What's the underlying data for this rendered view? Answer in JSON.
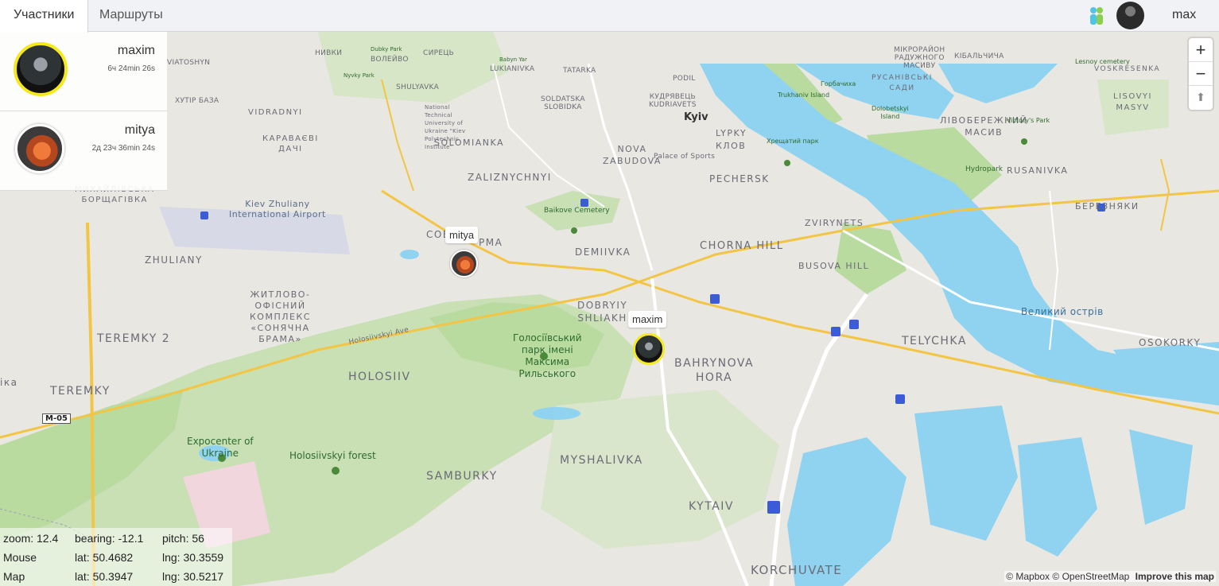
{
  "tabs": [
    {
      "label": "Участники",
      "active": true
    },
    {
      "label": "Маршруты",
      "active": false
    }
  ],
  "header": {
    "app_icon": "people-icon",
    "user_name": "max"
  },
  "participants": [
    {
      "name": "maxim",
      "time": "6ч 24min 26s",
      "highlighted": true
    },
    {
      "name": "mitya",
      "time": "2д 23ч 36min 24s",
      "highlighted": false
    }
  ],
  "markers": [
    {
      "label": "mitya"
    },
    {
      "label": "maxim"
    }
  ],
  "zoom": {
    "in_label": "+",
    "out_label": "−",
    "compass_label": "⬆"
  },
  "info": {
    "zoom_text": "zoom: 12.4",
    "bearing_text": "bearing: -12.1",
    "pitch_text": "pitch: 56",
    "mouse_label": "Mouse",
    "mouse_lat": "lat: 50.4682",
    "mouse_lng": "lng: 30.3559",
    "map_label": "Map",
    "map_lat": "lat: 50.3947",
    "map_lng": "lng: 30.5217"
  },
  "attribution": {
    "mapbox": "© Mapbox",
    "osm": "© OpenStreetMap",
    "improve": "Improve this map"
  },
  "map_labels": {
    "kyiv": "Kyiv",
    "solomianka": "SOLOMIANKA",
    "zaliznychnyi": "ZALIZNYCHNYI",
    "nova_zabudova": "NOVA\nZABUDOVA",
    "pechersk": "PECHERSK",
    "lypky": "LYPKY\nКЛОВ",
    "demiivka": "DEMIIVKA",
    "chorna_hill": "CHORNA HILL",
    "zvirynets": "ZVIRYNETS",
    "busova_hill": "BUSOVA HILL",
    "dobryi_shliakh": "DOBRYIY\nSHLIAKH",
    "bahrynova": "BAHRYNOVA\nHORA",
    "telychka": "TELYCHKA",
    "osokorky": "OSOKORKY",
    "holosiiv": "HOLOSIIV",
    "teremky": "TEREMKY",
    "teremky2": "TEREMKY 2",
    "zhuliany": "ZHULIANY",
    "myshalivka": "MYSHALIVKA",
    "samburky": "SAMBURKY",
    "kytaiv": "KYTAIV",
    "korchuvate": "KORCHUVATE",
    "rusanivka": "RUSANIVKA",
    "berezniaky": "БЕРЕЗНЯКИ",
    "livoberezhnyi": "ЛІВОБЕРЕЖНИЙ\nМАСИВ",
    "lisovyi": "LISOVYI\nMASYV",
    "vozkresenka": "VOSKRESENKA",
    "rusanivski": "РУСАНІВСЬКІ\nСАДИ",
    "vidradnyi": "VIDRADNYI",
    "karavaievi": "КАРАВАЄВІ\nДАЧІ",
    "mykhailivska": "МИХАЙЛІВСЬКА\nБОРЩАГІВКА",
    "soniachna": "ЖИТЛОВО-\nОФІСНИЙ\nКОМПЛЕКС\n«СОНЯЧНА\nБРАМА»",
    "holosiivskyi_park": "Голосіївський\nпарк імені\nМаксима\nРильського",
    "expocenter": "Expocenter of\nUkraine",
    "holosiivskyi_forest": "Holosiivskyi forest",
    "airport": "Kiev Zhuliany\nInternational Airport",
    "baikove": "Baikove Cemetery",
    "velykyi": "Великий острів",
    "holosiivskyi_ave": "Holosiivskyi Ave",
    "m05": "M-05",
    "shuliavka": "SHULYAVKA",
    "lukianivka": "LUKIANIVKA",
    "tatarka": "TATARKA",
    "podil": "PODIL",
    "soldatska": "SOLDATSKA\nSLOBIDKA",
    "kudriavets": "КУДРЯВЕЦЬ\nKUDRIAVETS",
    "sovska": "СОВ",
    "rma": "РМА",
    "hydropark": "Hydropark",
    "palace": "Palace of Sports",
    "khutir": "ХУТІР БАЗА",
    "nyvky": "НИВКИ",
    "syrets": "СИРЕЦЬ",
    "viatoshyn": "VIATOSHYN",
    "trukhaniv": "Trukhaniv Island",
    "dolobetskyi": "Dolobetskyi\nIsland",
    "horbachykha": "Горбачиха",
    "khreshchatyi": "Хрещатий парк",
    "victory": "Victory's Park",
    "kibalchych": "КІБАЛЬЧИЧА",
    "mikroraion": "МІКРОРАЙОН\nРАДУЖНОГО\nМАСИВУ",
    "leski": "Lesnoy cemetery",
    "ika": "іка",
    "nat_tech": "National\nTechnical\nUniversity of\nUkraine \"Kiev\nPolytechnic\nInstitute\"",
    "voleivo": "ВОЛЕЙВО",
    "dubky": "Dubky Park",
    "nyvky_park": "Nyvky Park",
    "babyn": "Babyn Yar"
  }
}
